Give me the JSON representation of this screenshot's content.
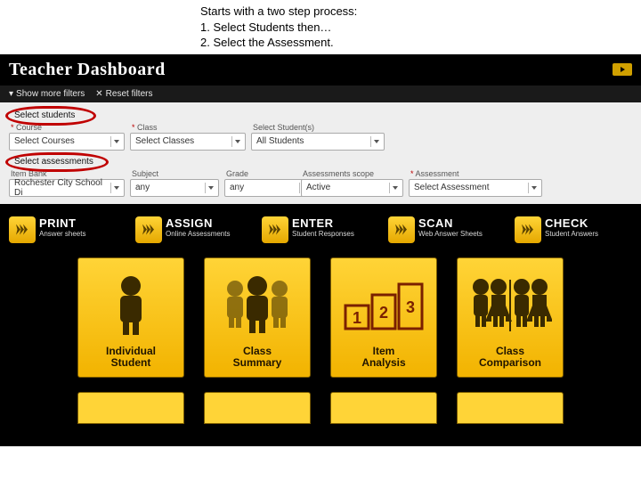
{
  "caption": {
    "line1": "Starts with a two step process:",
    "line2": "1.   Select Students then…",
    "line3": "2.   Select the Assessment."
  },
  "header": {
    "title": "Teacher Dashboard"
  },
  "filters_bar": {
    "show_more": "Show more filters",
    "reset": "Reset filters"
  },
  "students": {
    "heading": "Select students",
    "fields": {
      "course": {
        "label": "Course",
        "value": "Select Courses"
      },
      "classes": {
        "label": "Class",
        "value": "Select Classes"
      },
      "students": {
        "label": "Select Student(s)",
        "value": "All Students"
      }
    }
  },
  "assessments": {
    "heading": "Select assessments",
    "fields": {
      "itembank": {
        "label": "Item Bank",
        "value": "Rochester City School Di"
      },
      "subject": {
        "label": "Subject",
        "value": "any"
      },
      "grade": {
        "label": "Grade",
        "value": "any"
      },
      "scope": {
        "label": "Assessments scope",
        "value": "Active"
      },
      "assessment": {
        "label": "Assessment",
        "value": "Select Assessment"
      }
    }
  },
  "actions": [
    {
      "title": "PRINT",
      "sub": "Answer sheets"
    },
    {
      "title": "ASSIGN",
      "sub": "Online Assessments"
    },
    {
      "title": "ENTER",
      "sub": "Student Responses"
    },
    {
      "title": "SCAN",
      "sub": "Web Answer Sheets"
    },
    {
      "title": "CHECK",
      "sub": "Student Answers"
    }
  ],
  "tiles": [
    {
      "label": "Individual\nStudent"
    },
    {
      "label": "Class\nSummary"
    },
    {
      "label": "Item\nAnalysis"
    },
    {
      "label": "Class\nComparison"
    }
  ]
}
